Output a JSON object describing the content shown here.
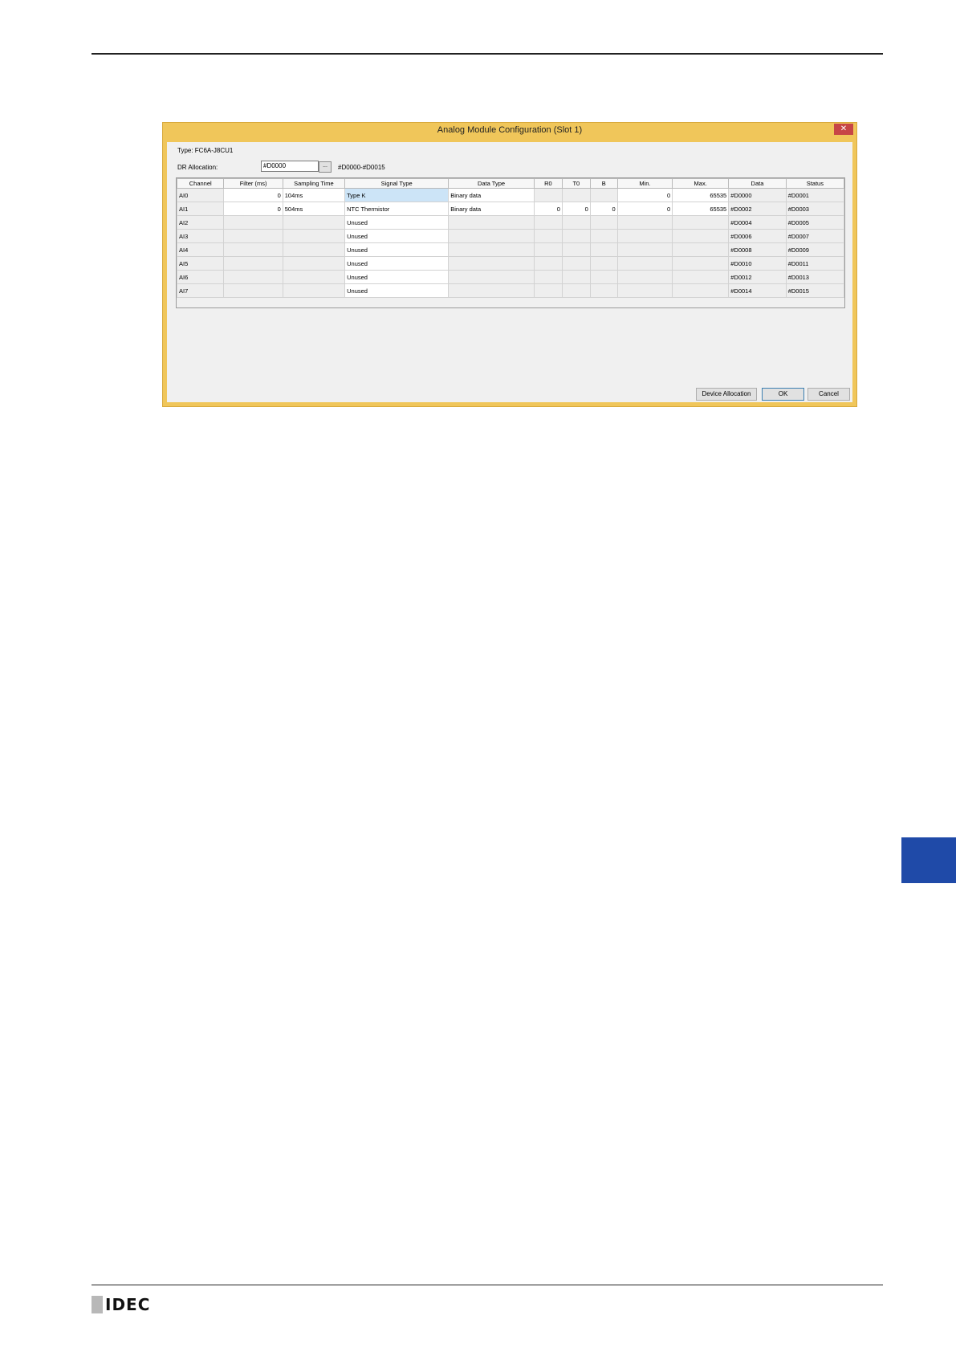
{
  "dialog": {
    "title": "Analog Module Configuration (Slot 1)",
    "close_glyph": "✕",
    "type_label": "Type: FC6A-J8CU1",
    "dr_allocation_label": "DR Allocation:",
    "dr_allocation_value": "#D0000",
    "browse_label": "...",
    "dr_range": "#D0000-#D0015"
  },
  "table": {
    "headers": [
      "Channel",
      "Filter (ms)",
      "Sampling Time",
      "Signal Type",
      "Data Type",
      "R0",
      "T0",
      "B",
      "Min.",
      "Max.",
      "Data",
      "Status"
    ],
    "rows": [
      {
        "channel": "AI0",
        "filter": "0",
        "sampling": "104ms",
        "signal": "Type K",
        "data_type": "Binary data",
        "r0": "",
        "t0": "",
        "b": "",
        "min": "0",
        "max": "65535",
        "data": "#D0000",
        "status": "#D0001"
      },
      {
        "channel": "AI1",
        "filter": "0",
        "sampling": "504ms",
        "signal": "NTC Thermistor",
        "data_type": "Binary data",
        "r0": "0",
        "t0": "0",
        "b": "0",
        "min": "0",
        "max": "65535",
        "data": "#D0002",
        "status": "#D0003"
      },
      {
        "channel": "AI2",
        "filter": "",
        "sampling": "",
        "signal": "Unused",
        "data_type": "",
        "r0": "",
        "t0": "",
        "b": "",
        "min": "",
        "max": "",
        "data": "#D0004",
        "status": "#D0005"
      },
      {
        "channel": "AI3",
        "filter": "",
        "sampling": "",
        "signal": "Unused",
        "data_type": "",
        "r0": "",
        "t0": "",
        "b": "",
        "min": "",
        "max": "",
        "data": "#D0006",
        "status": "#D0007"
      },
      {
        "channel": "AI4",
        "filter": "",
        "sampling": "",
        "signal": "Unused",
        "data_type": "",
        "r0": "",
        "t0": "",
        "b": "",
        "min": "",
        "max": "",
        "data": "#D0008",
        "status": "#D0009"
      },
      {
        "channel": "AI5",
        "filter": "",
        "sampling": "",
        "signal": "Unused",
        "data_type": "",
        "r0": "",
        "t0": "",
        "b": "",
        "min": "",
        "max": "",
        "data": "#D0010",
        "status": "#D0011"
      },
      {
        "channel": "AI6",
        "filter": "",
        "sampling": "",
        "signal": "Unused",
        "data_type": "",
        "r0": "",
        "t0": "",
        "b": "",
        "min": "",
        "max": "",
        "data": "#D0012",
        "status": "#D0013"
      },
      {
        "channel": "AI7",
        "filter": "",
        "sampling": "",
        "signal": "Unused",
        "data_type": "",
        "r0": "",
        "t0": "",
        "b": "",
        "min": "",
        "max": "",
        "data": "#D0014",
        "status": "#D0015"
      }
    ]
  },
  "buttons": {
    "device_allocation": "Device Allocation",
    "ok": "OK",
    "cancel": "Cancel"
  },
  "footer": {
    "logo_text": "IDEC"
  },
  "colors": {
    "dialog_frame": "#f0c65a",
    "close_button": "#c74646",
    "side_tab": "#1f4aa8",
    "selected_cell": "#cce4f7"
  }
}
